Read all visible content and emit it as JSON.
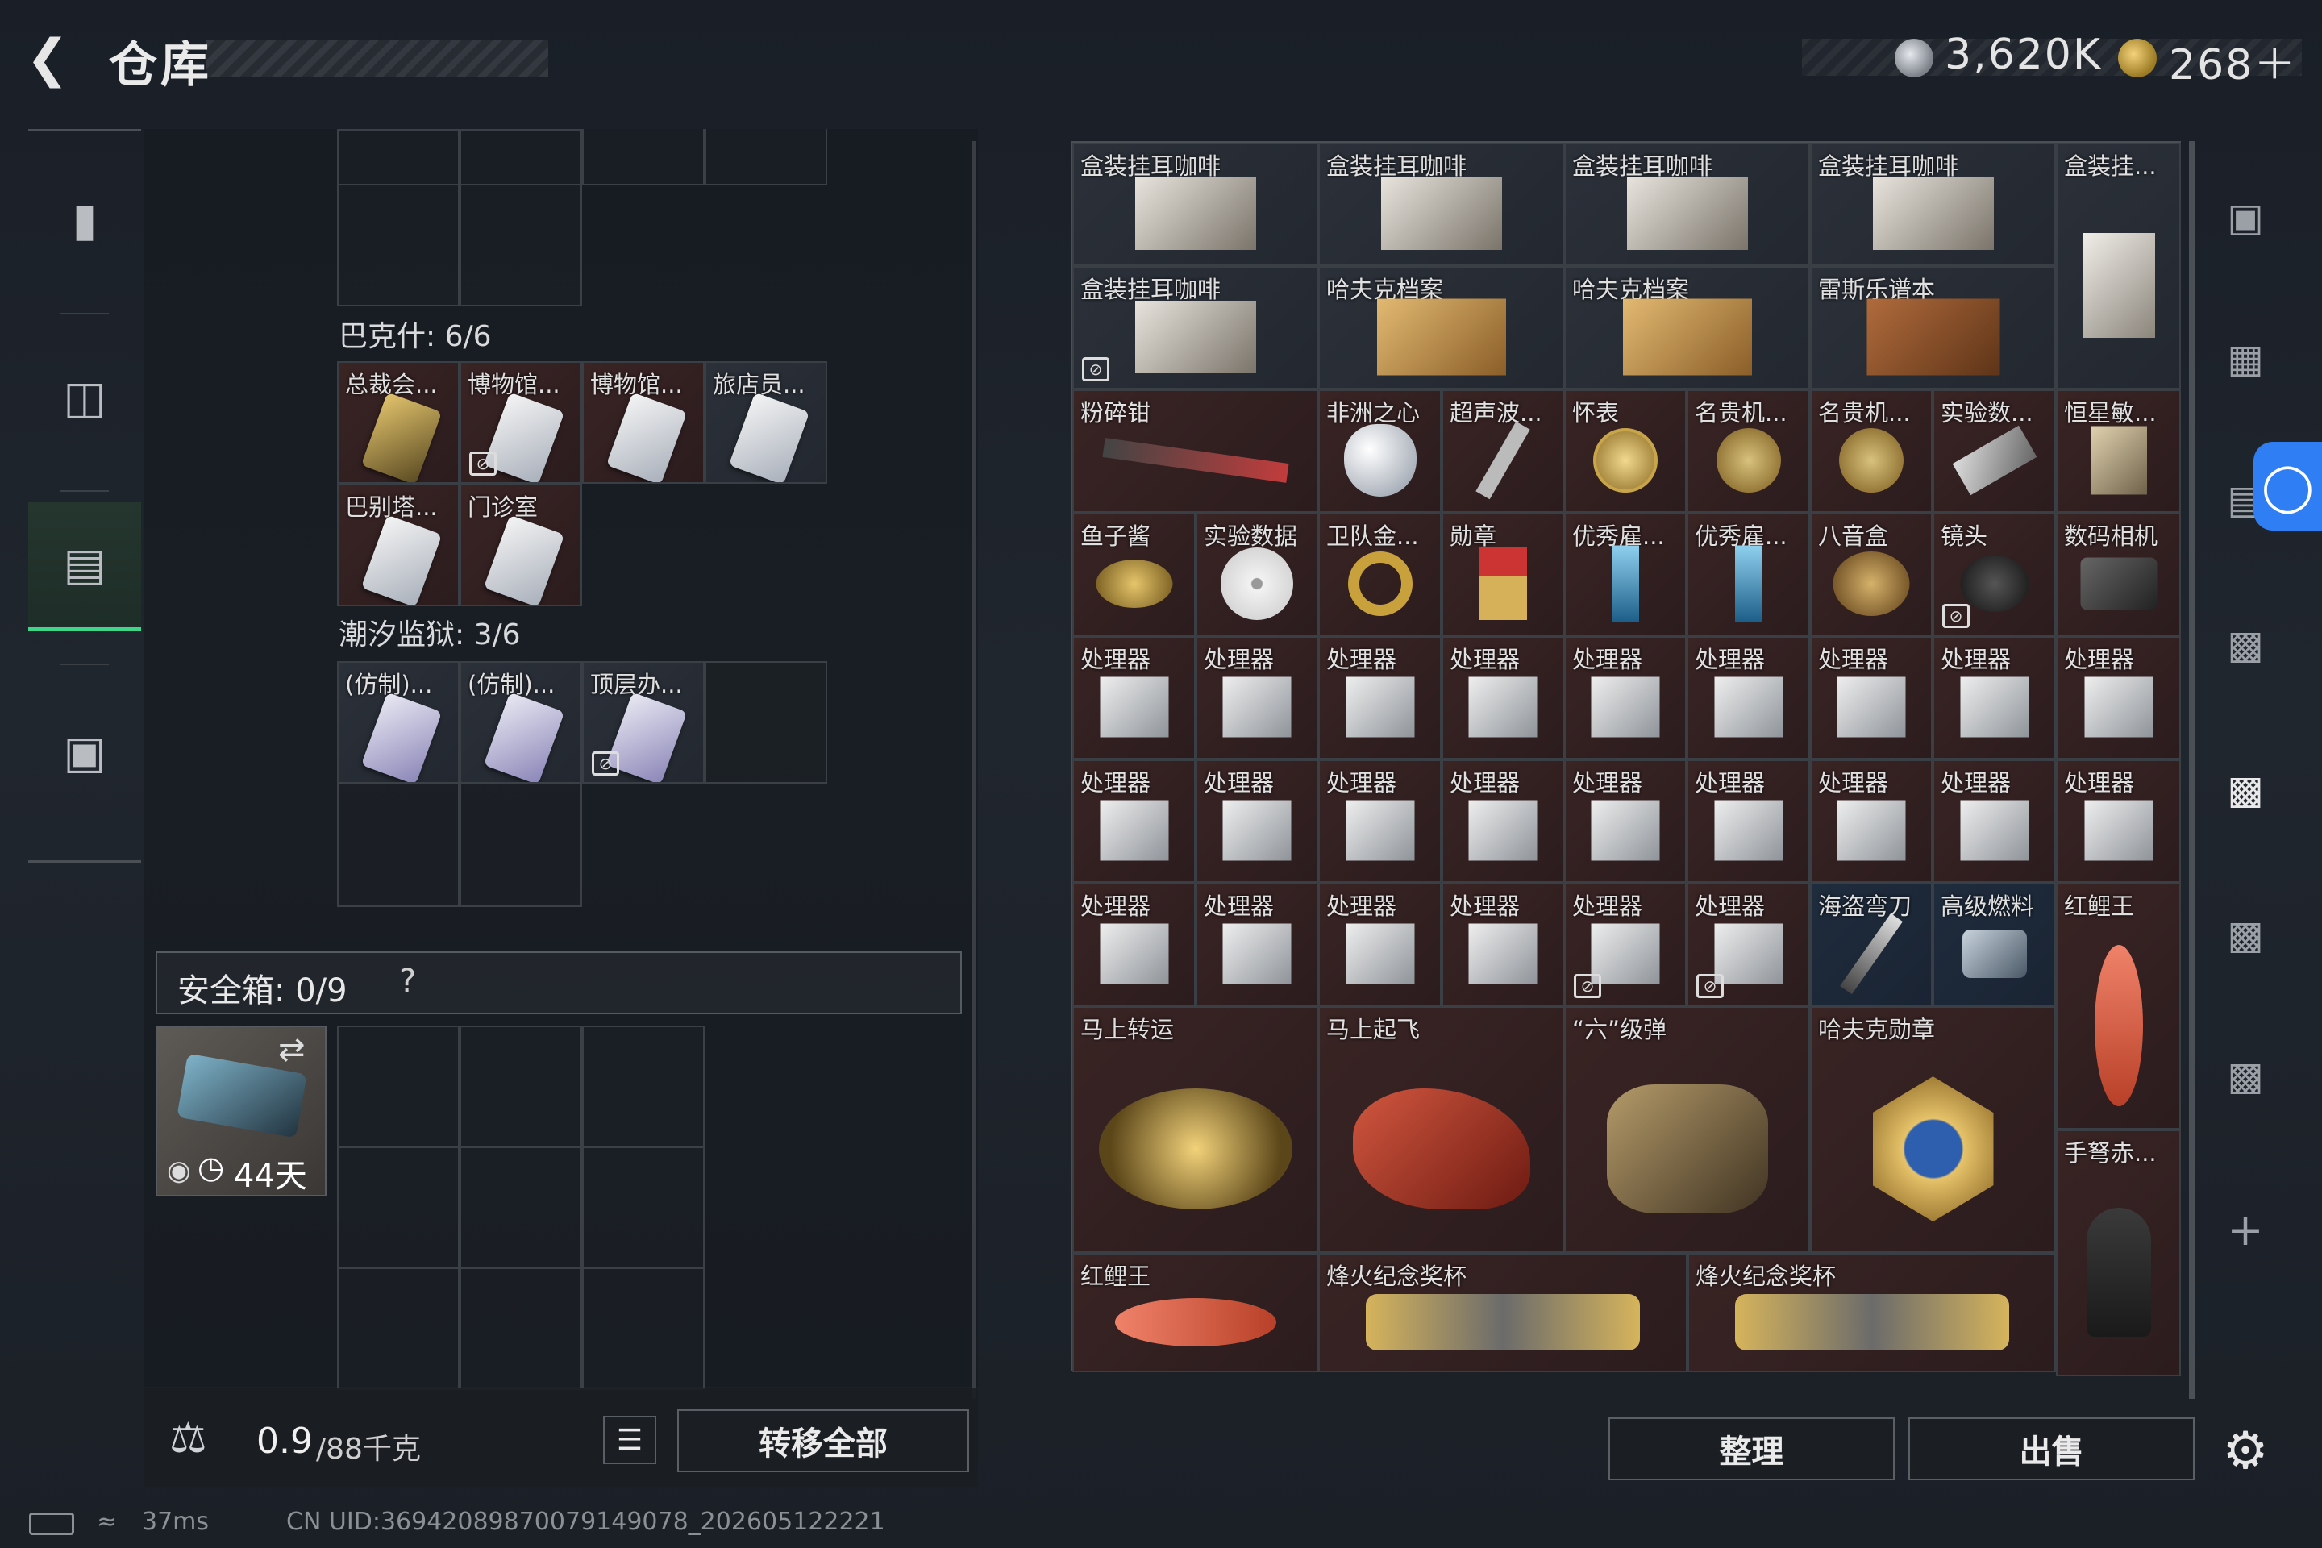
{
  "header": {
    "back_icon": "chevron-left-icon",
    "title": "仓库",
    "currency1": "3,620K",
    "currency2": "268＋"
  },
  "left_nav": [
    {
      "icon": "gun-icon"
    },
    {
      "icon": "backpack-icon"
    },
    {
      "icon": "vest-icon"
    },
    {
      "icon": "briefcase-icon"
    }
  ],
  "sections": {
    "s1": "巴克什: 6/6",
    "s1_items": [
      "总裁会...",
      "博物馆...",
      "博物馆...",
      "旅店员...",
      "巴别塔...",
      "门诊室"
    ],
    "s2": "潮汐监狱: 3/6",
    "s2_items": [
      "(仿制)...",
      "(仿制)...",
      "顶层办..."
    ]
  },
  "safe": {
    "label": "安全箱: 0/9",
    "help": "?",
    "days": "44天"
  },
  "bottom": {
    "weight": "0.9",
    "weight_cap": "/88千克",
    "transfer_all": "转移全部"
  },
  "grid": {
    "row1": [
      "盒装挂耳咖啡",
      "盒装挂耳咖啡",
      "盒装挂耳咖啡",
      "盒装挂耳咖啡",
      "盒装挂..."
    ],
    "row2": [
      "盒装挂耳咖啡",
      "哈夫克档案",
      "哈夫克档案",
      "雷斯乐谱本"
    ],
    "row3": [
      "粉碎钳",
      "非洲之心",
      "超声波...",
      "怀表",
      "名贵机...",
      "名贵机...",
      "实验数...",
      "恒星敏..."
    ],
    "row4": [
      "鱼子酱",
      "实验数据",
      "卫队金...",
      "勋章",
      "优秀雇...",
      "优秀雇...",
      "八音盒",
      "镜头",
      "数码相机"
    ],
    "processor": "处理器",
    "row7": [
      "海盗弯刀",
      "高级燃料",
      "红鲤王"
    ],
    "row8": [
      "马上转运",
      "马上起飞",
      "“六”级弹",
      "哈夫克勋章",
      "手弩赤..."
    ],
    "row9": [
      "红鲤王",
      "烽火纪念奖杯",
      "烽火纪念奖杯"
    ]
  },
  "actions": {
    "sort": "整理",
    "sell": "出售"
  },
  "status": {
    "ping": "37ms",
    "uid": "CN UID:36942089870079149078_202605122221"
  }
}
